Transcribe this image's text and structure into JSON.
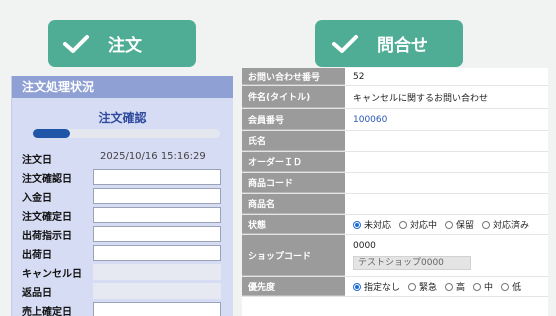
{
  "tabs": {
    "order_label": "注文",
    "inquiry_label": "問合せ"
  },
  "order_panel": {
    "title": "注文処理状況",
    "status_label": "注文確認",
    "progress_fraction": 0.2,
    "fields": [
      {
        "label": "注文日",
        "value": "2025/10/16 15:16:29"
      },
      {
        "label": "注文確認日",
        "value": ""
      },
      {
        "label": "入金日",
        "value": ""
      },
      {
        "label": "注文確定日",
        "value": ""
      },
      {
        "label": "出荷指示日",
        "value": ""
      },
      {
        "label": "出荷日",
        "value": ""
      },
      {
        "label": "キャンセル日",
        "value": ""
      },
      {
        "label": "返品日",
        "value": ""
      },
      {
        "label": "売上確定日",
        "value": ""
      }
    ]
  },
  "inquiry_table": {
    "rows": [
      {
        "label": "お問い合わせ番号",
        "value": "52"
      },
      {
        "label": "件名(タイトル)",
        "value": "キャンセルに関するお問い合わせ"
      },
      {
        "label": "会員番号",
        "value": "100060"
      },
      {
        "label": "氏名",
        "value": ""
      },
      {
        "label": "オーダーＩＤ",
        "value": ""
      },
      {
        "label": "商品コード",
        "value": ""
      },
      {
        "label": "商品名",
        "value": ""
      }
    ],
    "status_label": "状態",
    "status_options": [
      "未対応",
      "対応中",
      "保留",
      "対応済み"
    ],
    "shop_label": "ショップコード",
    "shop_code": "0000",
    "shop_name": "テストショップ0000",
    "priority_label": "優先度",
    "priority_options": [
      "指定なし",
      "緊急",
      "高",
      "中",
      "低"
    ]
  },
  "colors": {
    "accent": "#4ead94",
    "panel_header": "#8fa0d4",
    "table_key": "#9b9b9b",
    "radio": "#1f6fd6"
  }
}
